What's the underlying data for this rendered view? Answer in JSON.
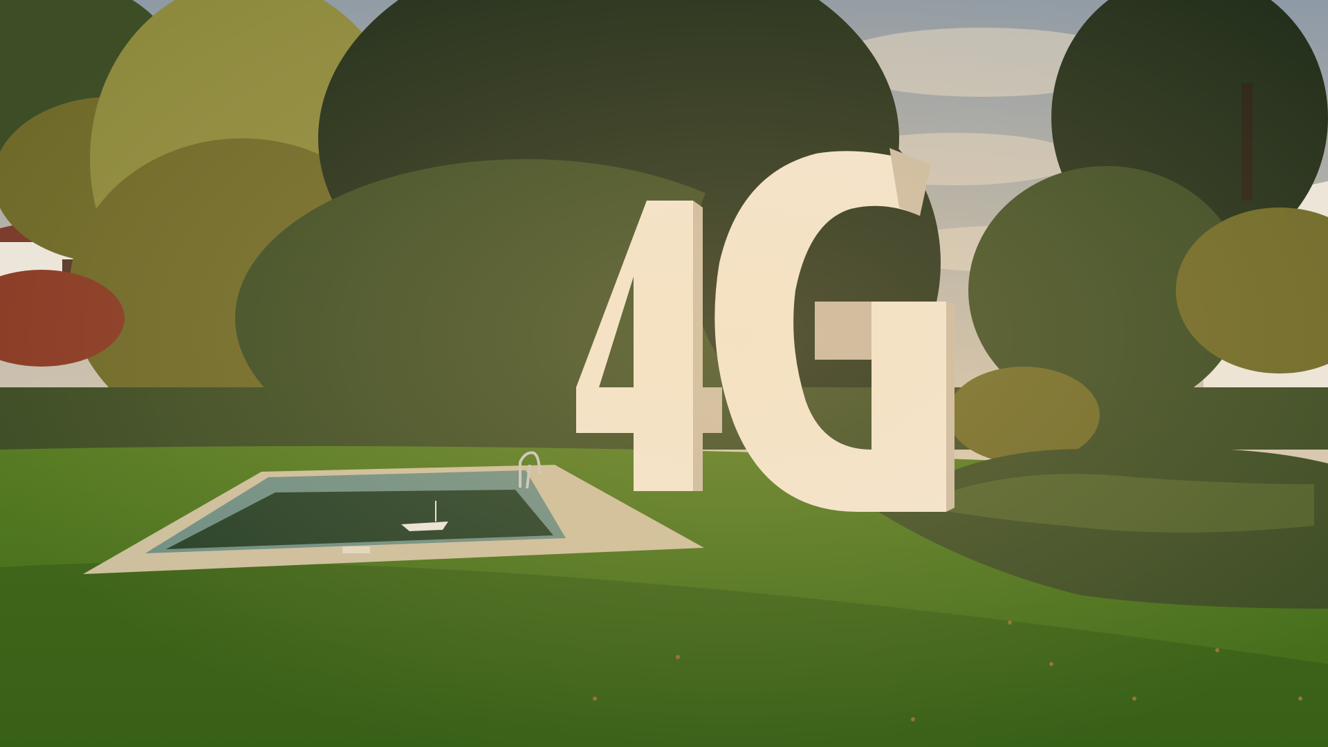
{
  "scene": {
    "sign_text": "4G",
    "palette": {
      "sky_top": "#8e9aa6",
      "sky_bottom": "#d8c9b2",
      "cloud": "#e6d8c4",
      "foliage_dark": "#24301c",
      "foliage_mid": "#3d4d26",
      "foliage_warm": "#6f6a2a",
      "foliage_light": "#8d8a3e",
      "lawn_far": "#557a22",
      "lawn_near": "#3f6a1a",
      "pool_edge": "#cdbf9f",
      "pool_water": "#27412a",
      "pool_tile": "#6f8f86",
      "letter_face": "#f2e6d3",
      "letter_side": "#cbbca6",
      "letter_shadow": "#a89a86",
      "house_wall": "#ece6dc",
      "house_roof": "#7b3a2a",
      "shrub_red": "#8a3b26"
    }
  }
}
